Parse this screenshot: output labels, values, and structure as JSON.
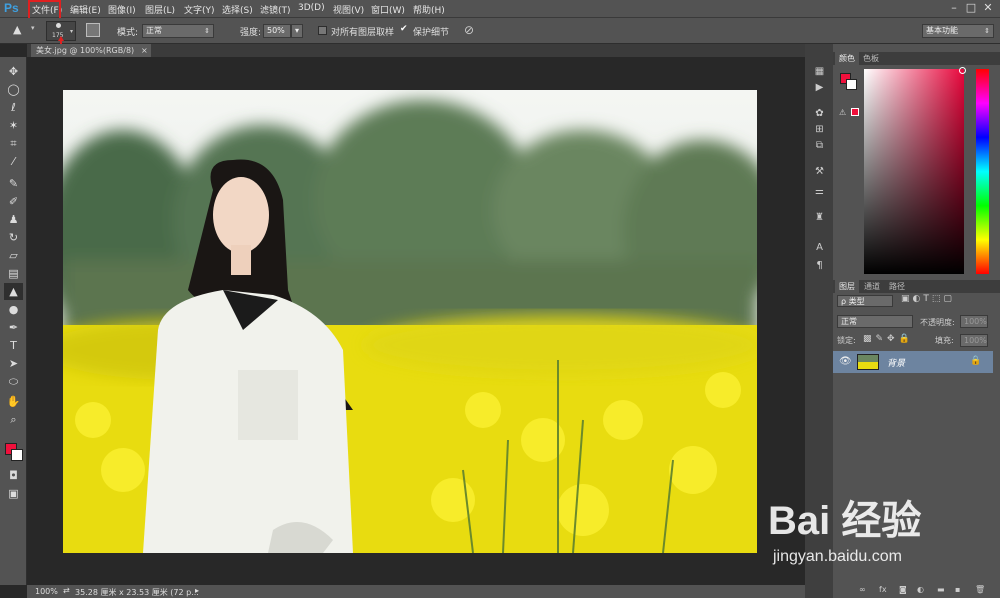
{
  "menubar": {
    "logo": "Ps",
    "items": [
      "文件(F)",
      "编辑(E)",
      "图像(I)",
      "图层(L)",
      "文字(Y)",
      "选择(S)",
      "滤镜(T)",
      "3D(D)",
      "视图(V)",
      "窗口(W)",
      "帮助(H)"
    ],
    "window_controls": [
      "–",
      "□",
      "✕"
    ]
  },
  "options": {
    "brush_size": "175",
    "mode_label": "模式:",
    "mode_value": "正常",
    "strength_label": "强度:",
    "strength_value": "50%",
    "sample_all_layers": "对所有图层取样",
    "protect_detail": "保护细节",
    "workspace": "基本功能"
  },
  "document": {
    "tab_title": "美女.jpg @ 100%(RGB/8)",
    "tab_close": "×"
  },
  "status": {
    "zoom": "100%",
    "info": "35.28 厘米 x 23.53 厘米 (72 p..."
  },
  "color_panel": {
    "tabs": [
      "颜色",
      "色板"
    ]
  },
  "layers_panel": {
    "tabs": [
      "图层",
      "通道",
      "路径"
    ],
    "filter_label": "ρ 类型",
    "blend_mode": "正常",
    "opacity_label": "不透明度:",
    "opacity_value": "100%",
    "lock_label": "锁定:",
    "fill_label": "填充:",
    "fill_value": "100%",
    "layers": [
      {
        "name": "背景"
      }
    ],
    "footer_icons": [
      "link-icon",
      "fx-icon",
      "mask-icon",
      "adjustment-icon",
      "group-icon",
      "new-layer-icon",
      "trash-icon"
    ]
  },
  "watermark": {
    "brand": "Bai 经验",
    "url": "jingyan.baidu.com"
  },
  "colors": {
    "foreground": "#f0103c",
    "background": "#ffffff",
    "ui_panel": "#535353",
    "highlight_box": "#e02020"
  }
}
